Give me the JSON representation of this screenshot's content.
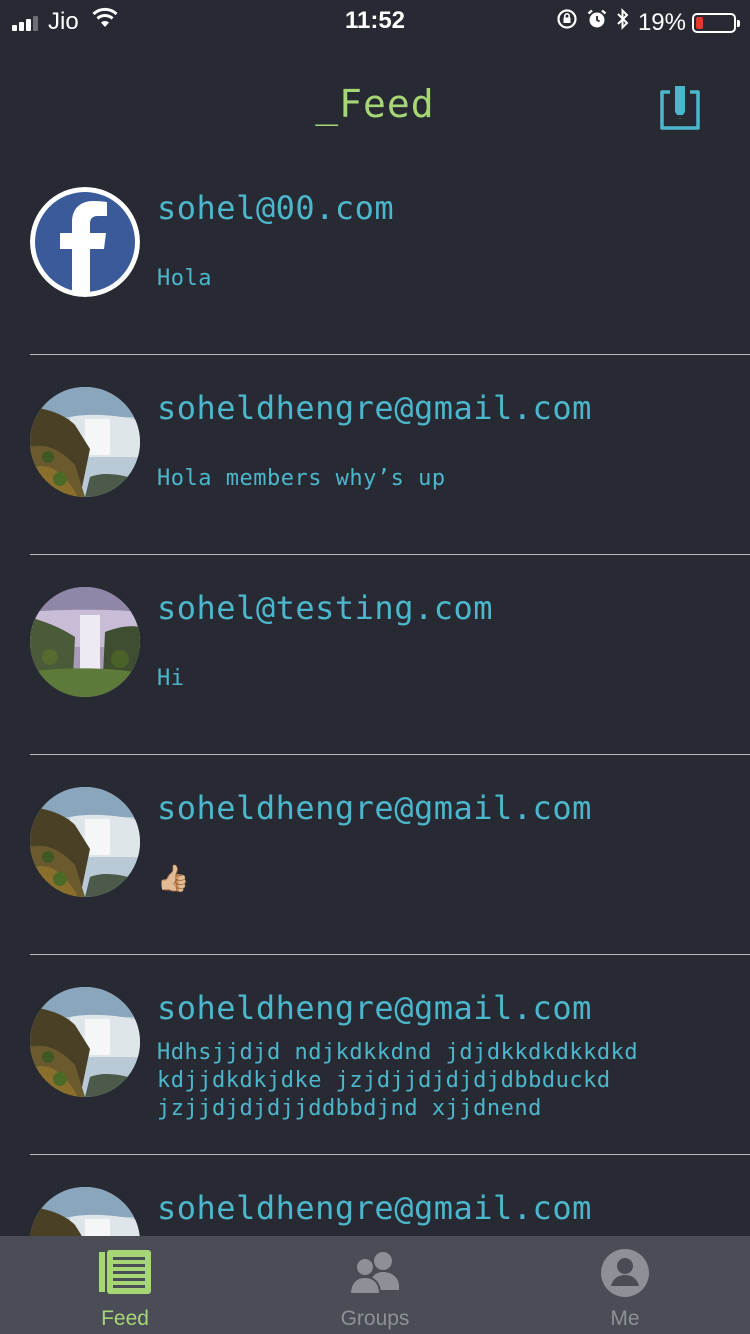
{
  "status_bar": {
    "carrier": "Jio",
    "time": "11:52",
    "battery_percent": "19%",
    "battery_level": 0.19,
    "icons": [
      "signal-icon",
      "wifi-icon",
      "rotation-lock-icon",
      "alarm-icon",
      "bluetooth-icon",
      "battery-icon"
    ]
  },
  "nav": {
    "title": "_Feed",
    "compose_icon": "compose-icon"
  },
  "feed": [
    {
      "email": "sohel@00.com",
      "text": "Hola",
      "avatar": "facebook-logo"
    },
    {
      "email": "soheldhengre@gmail.com",
      "text": "Hola members why’s up",
      "avatar": "waterfall-photo"
    },
    {
      "email": "sohel@testing.com",
      "text": "Hi",
      "avatar": "waterfall-photo-2"
    },
    {
      "email": "soheldhengre@gmail.com",
      "text": "👍🏼",
      "avatar": "waterfall-photo"
    },
    {
      "email": "soheldhengre@gmail.com",
      "text": "Hdhsjjdjd ndjkdkkdnd jdjdkkdkdkkdkd kdjjdkdkjdke jzjdjjdjdjdjdbbduckd jzjjdjdjdjjddbbdjnd xjjdnend",
      "avatar": "waterfall-photo"
    },
    {
      "email": "soheldhengre@gmail.com",
      "text": "",
      "avatar": "waterfall-photo"
    }
  ],
  "tabs": [
    {
      "label": "Feed",
      "icon": "feed-icon",
      "active": true
    },
    {
      "label": "Groups",
      "icon": "groups-icon",
      "active": false
    },
    {
      "label": "Me",
      "icon": "profile-icon",
      "active": false
    }
  ],
  "colors": {
    "background": "#282a33",
    "accent_green": "#a7d677",
    "text_cyan": "#4cb7cc",
    "tab_bar": "#4a4d55",
    "battery_low": "#e5362f"
  }
}
